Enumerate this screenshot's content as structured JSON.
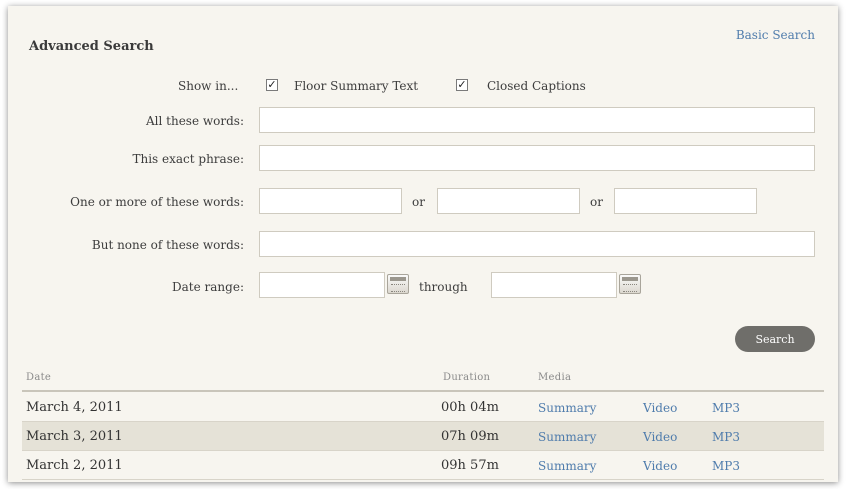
{
  "search": {
    "title": "Advanced Search",
    "basic_link": "Basic Search",
    "show_in_label": "Show in...",
    "options": [
      {
        "label": "Floor Summary Text",
        "checked": true
      },
      {
        "label": "Closed Captions",
        "checked": true
      }
    ],
    "all_words_label": "All these words:",
    "all_words_value": "",
    "exact_phrase_label": "This exact phrase:",
    "exact_phrase_value": "",
    "any_words_label": "One or more of these words:",
    "any_words_values": [
      "",
      "",
      ""
    ],
    "or_label": "or",
    "none_words_label": "But none of these words:",
    "none_words_value": "",
    "date_range_label": "Date range:",
    "date_from": "",
    "through_label": "through",
    "date_to": "",
    "search_button": "Search"
  },
  "results": {
    "columns": [
      "Date",
      "Duration",
      "Media"
    ],
    "rows": [
      {
        "date": "March 4, 2011",
        "duration": "00h 04m",
        "summary": "Summary",
        "video": "Video",
        "mp3": "MP3"
      },
      {
        "date": "March 3, 2011",
        "duration": "07h 09m",
        "summary": "Summary",
        "video": "Video",
        "mp3": "MP3"
      },
      {
        "date": "March 2, 2011",
        "duration": "09h 57m",
        "summary": "Summary",
        "video": "Video",
        "mp3": "MP3"
      }
    ]
  },
  "colors": {
    "panel_bg": "#f7f5ef",
    "link": "#4f7cac",
    "alt_row": "#e5e2d7",
    "button": "#6f6e6a"
  }
}
